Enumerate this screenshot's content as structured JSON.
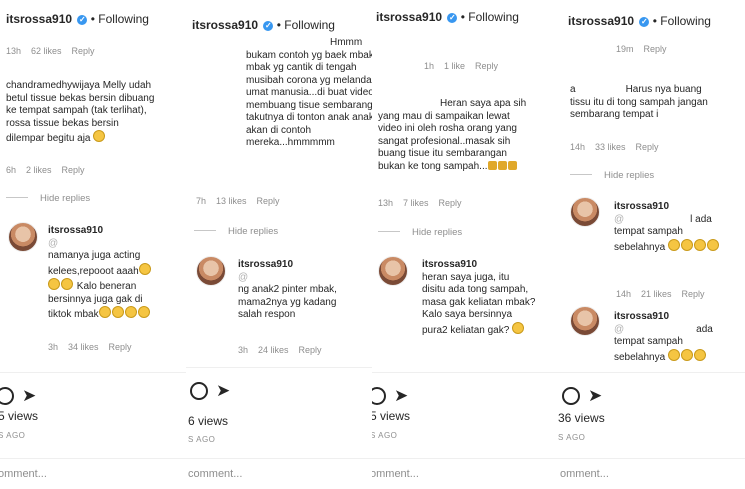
{
  "header": {
    "username": "itsrossa910",
    "following": "• Following"
  },
  "panels": [
    {
      "top_meta": [
        "13h",
        "62 likes",
        "Reply"
      ],
      "comment1_lines": [
        "chandramedhywijaya Melly udah",
        "betul tissue bekas bersin dibuang",
        "ke tempat sampah (tak terlihat),",
        "rossa tissue bekas bersin",
        "dilempar begitu aja"
      ],
      "comment1_meta": [
        "6h",
        "2 likes",
        "Reply"
      ],
      "hide_replies": "Hide replies",
      "reply_user": "itsrossa910",
      "reply_lines": [
        "@",
        "namanya juga acting",
        "kelees,repooot aaah",
        "Kalo beneran",
        "bersinnya juga gak di",
        "tiktok mbak"
      ],
      "reply_meta": [
        "3h",
        "34 likes",
        "Reply"
      ],
      "views": "5 views",
      "ago": "S AGO",
      "comment_placeholder": "omment..."
    },
    {
      "comment1_lines": [
        "Hmmm",
        "bukam contoh yg baek mbak",
        "mbak yg cantik di tengah",
        "musibah corona yg melanda",
        "umat manusia...di buat video",
        "membuang tisue sembarangan...",
        "takutnya di tonton anak anak",
        "akan di contoh",
        "mereka...hmmmmm"
      ],
      "comment1_meta": [
        "7h",
        "13 likes",
        "Reply"
      ],
      "hide_replies": "Hide replies",
      "reply_user": "itsrossa910",
      "reply_lines": [
        "@",
        "ng anak2 pinter mbak,",
        "mama2nya yg kadang",
        "salah respon"
      ],
      "reply_meta": [
        "3h",
        "24 likes",
        "Reply"
      ],
      "views": "6 views",
      "ago": "S AGO",
      "comment_placeholder": "comment..."
    },
    {
      "top_meta": [
        "1h",
        "1 like",
        "Reply"
      ],
      "comment1_lines": [
        "Heran saya apa sih",
        "yang mau di sampaikan lewat",
        "video ini oleh rosha orang yang",
        "sangat profesional..masak sih",
        "buang tisue itu sembarangan",
        "bukan ke tong sampah..."
      ],
      "comment1_meta": [
        "13h",
        "7 likes",
        "Reply"
      ],
      "hide_replies": "Hide replies",
      "reply_user": "itsrossa910",
      "reply_lines": [
        "heran saya juga, itu",
        "disitu ada tong sampah,",
        "masa gak keliatan mbak?",
        "Kalo saya bersinnya",
        "pura2 keliatan gak?"
      ],
      "views": "5 views",
      "ago": "S AGO",
      "comment_placeholder": "omment..."
    },
    {
      "top_meta": [
        "19m",
        "Reply"
      ],
      "comment1_prefix": "a",
      "comment1_lines": [
        "Harus nya buang",
        "tissu itu di tong sampah jangan",
        "sembarang tempat i"
      ],
      "comment1_meta": [
        "14h",
        "33 likes",
        "Reply"
      ],
      "hide_replies": "Hide replies",
      "reply_user": "itsrossa910",
      "reply_lines": [
        "@",
        "l ada",
        "tempat sampah",
        "sebelahnya"
      ],
      "reply_meta": [
        "14h",
        "21 likes",
        "Reply"
      ],
      "reply2_user": "itsrossa910",
      "reply2_lines": [
        "@",
        "ada",
        "tempat sampah",
        "sebelahnya"
      ],
      "views": "36 views",
      "ago": "S AGO",
      "comment_placeholder": "omment..."
    }
  ],
  "colors": {
    "text": "#262626",
    "meta": "#8e8e8e",
    "verified": "#3897f0"
  },
  "icons": [
    "comment-icon",
    "share-icon",
    "verified-icon",
    "emoji-icon",
    "thumbs-down-icon"
  ]
}
